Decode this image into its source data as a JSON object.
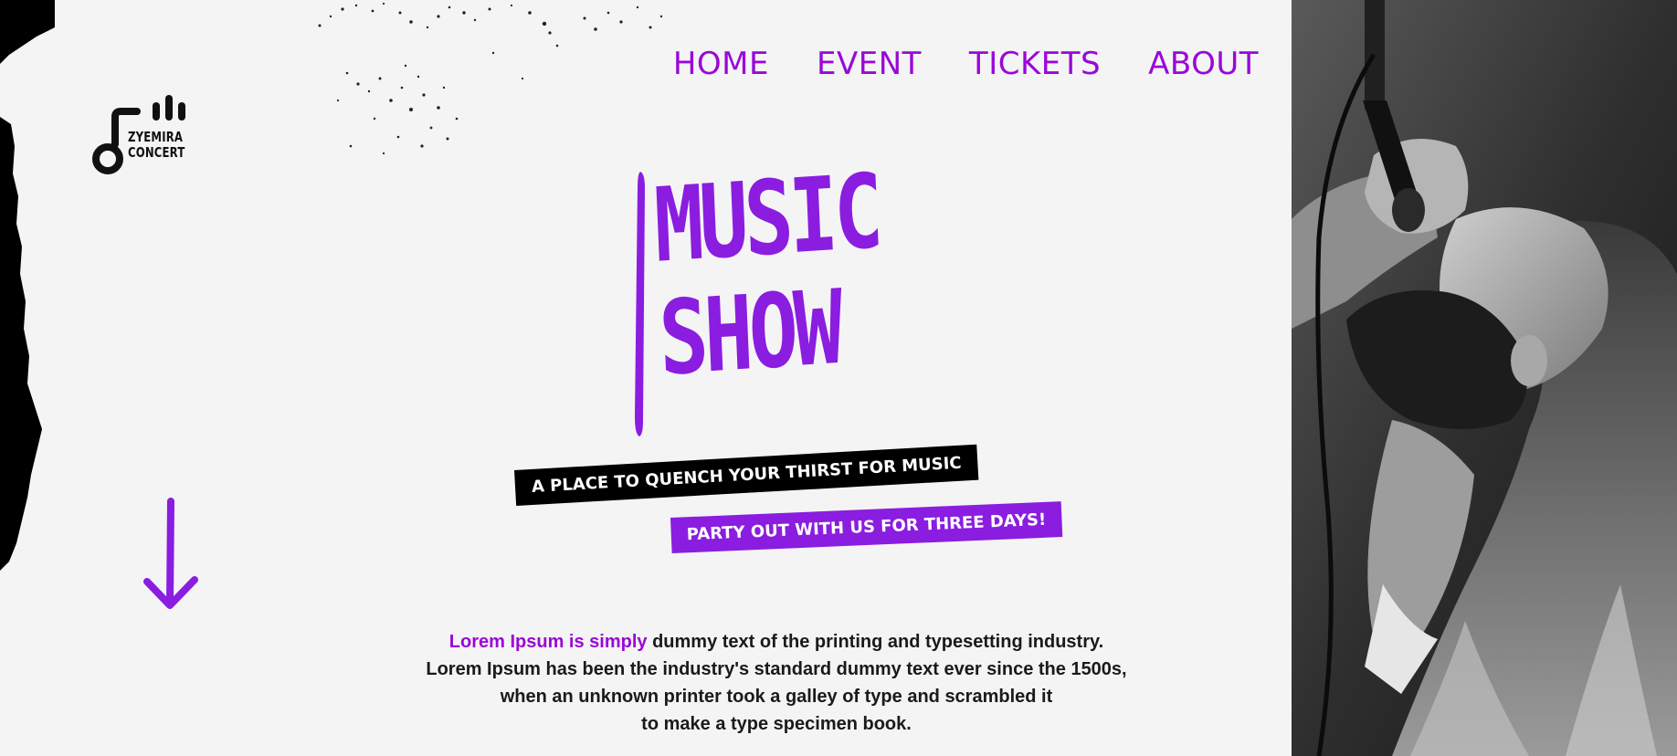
{
  "brand": {
    "line1": "ZYEMIRA",
    "line2": "CONCERT"
  },
  "nav": {
    "items": [
      {
        "label": "HOME"
      },
      {
        "label": "EVENT"
      },
      {
        "label": "TICKETS"
      },
      {
        "label": "ABOUT"
      }
    ]
  },
  "hero": {
    "title_line1": "MUSIC",
    "title_line2": "SHOW",
    "tagline": "A PLACE TO QUENCH YOUR THIRST FOR MUSIC",
    "subtagline": "PARTY OUT WITH US FOR THREE DAYS!"
  },
  "description": {
    "highlight": "Lorem Ipsum is simply",
    "line1": " dummy text of the printing and typesetting industry.",
    "line2": "Lorem Ipsum has been the industry's standard dummy text ever since the 1500s,",
    "line3": "when an unknown printer took a galley of type and scrambled it",
    "line4": "to make a type specimen book."
  },
  "icons": {
    "logo": "music-note-logo-icon",
    "scroll": "arrow-down-icon"
  },
  "colors": {
    "accent": "#8a1de0",
    "nav": "#9a07d8",
    "background": "#f4f4f4",
    "dark": "#000000"
  }
}
